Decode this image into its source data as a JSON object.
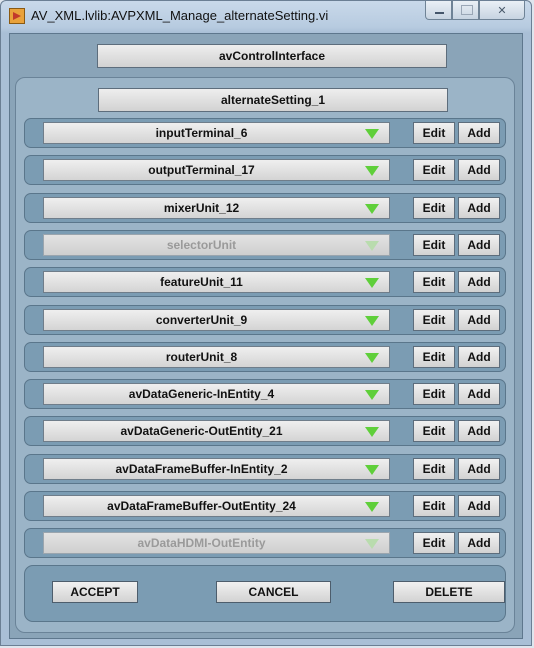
{
  "window": {
    "title": "AV_XML.lvlib:AVPXML_Manage_alternateSetting.vi"
  },
  "control_interface_label": "avControlInterface",
  "alternate_setting_label": "alternateSetting_1",
  "rows": [
    {
      "label": "inputTerminal_6",
      "enabled": true
    },
    {
      "label": "outputTerminal_17",
      "enabled": true
    },
    {
      "label": "mixerUnit_12",
      "enabled": true
    },
    {
      "label": "selectorUnit",
      "enabled": false
    },
    {
      "label": "featureUnit_11",
      "enabled": true
    },
    {
      "label": "converterUnit_9",
      "enabled": true
    },
    {
      "label": "routerUnit_8",
      "enabled": true
    },
    {
      "label": "avDataGeneric-InEntity_4",
      "enabled": true
    },
    {
      "label": "avDataGeneric-OutEntity_21",
      "enabled": true
    },
    {
      "label": "avDataFrameBuffer-InEntity_2",
      "enabled": true
    },
    {
      "label": "avDataFrameBuffer-OutEntity_24",
      "enabled": true
    },
    {
      "label": "avDataHDMI-OutEntity",
      "enabled": false
    }
  ],
  "row_buttons": {
    "edit": "Edit",
    "add": "Add"
  },
  "actions": {
    "accept": "ACCEPT",
    "cancel": "CANCEL",
    "delete": "DELETE"
  },
  "colors": {
    "dropdown_arrow": "#5fcf3a",
    "panel": "#9bb4c7",
    "row_bg": "#7b9cb3"
  }
}
